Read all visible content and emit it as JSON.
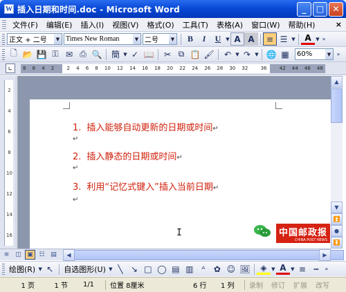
{
  "window": {
    "title": "插入日期和时间.doc - Microsoft Word",
    "app_icon_letter": "W",
    "minimize": "_",
    "maximize": "□",
    "close": "✕"
  },
  "menubar": {
    "items": [
      "文件(F)",
      "编辑(E)",
      "插入(I)",
      "视图(V)",
      "格式(O)",
      "工具(T)",
      "表格(A)",
      "窗口(W)",
      "帮助(H)"
    ],
    "close_doc": "×"
  },
  "format_toolbar": {
    "style": "正文 + 二号",
    "font": "Times New Roman",
    "size": "二号",
    "bold": "B",
    "italic": "I",
    "underline": "U",
    "font_color": "A"
  },
  "standard_toolbar": {
    "zoom": "60%"
  },
  "ruler": {
    "numbers": [
      "8",
      "6",
      "4",
      "2",
      "",
      "2",
      "4",
      "6",
      "8",
      "10",
      "12",
      "14",
      "16",
      "18",
      "20",
      "22",
      "24",
      "26",
      "28",
      "30",
      "32",
      "",
      "36",
      "",
      "42",
      "44",
      "46",
      "48"
    ],
    "vertical_numbers": [
      "2",
      "4",
      "6",
      "8",
      "10",
      "12",
      "14",
      "16"
    ]
  },
  "document": {
    "lines": [
      {
        "num": "1.",
        "text": "插入能够自动更新的日期或时间"
      },
      {
        "num": "2.",
        "text": "插入静态的日期或时间"
      },
      {
        "num": "3.",
        "text": "利用“记忆式键入”插入当前日期"
      }
    ],
    "para_mark": "↵",
    "ibeam": "I"
  },
  "watermark": {
    "logo_text": "中国邮政报",
    "logo_sub": "CHINA POST NEWS"
  },
  "drawbar": {
    "draw_label": "绘图(R)",
    "autoshape_label": "自选图形(U)"
  },
  "statusbar": {
    "page": "1 页",
    "section": "1 节",
    "page_of": "1/1",
    "position": "位置 8厘米",
    "line": "6 行",
    "column": "1 列",
    "record": "录制",
    "revise": "修订",
    "extend": "扩展",
    "overwrite": "改写"
  },
  "colors": {
    "title_bar": "#0a4ad8",
    "doc_text": "#d0200c",
    "logo_red": "#d52213"
  }
}
